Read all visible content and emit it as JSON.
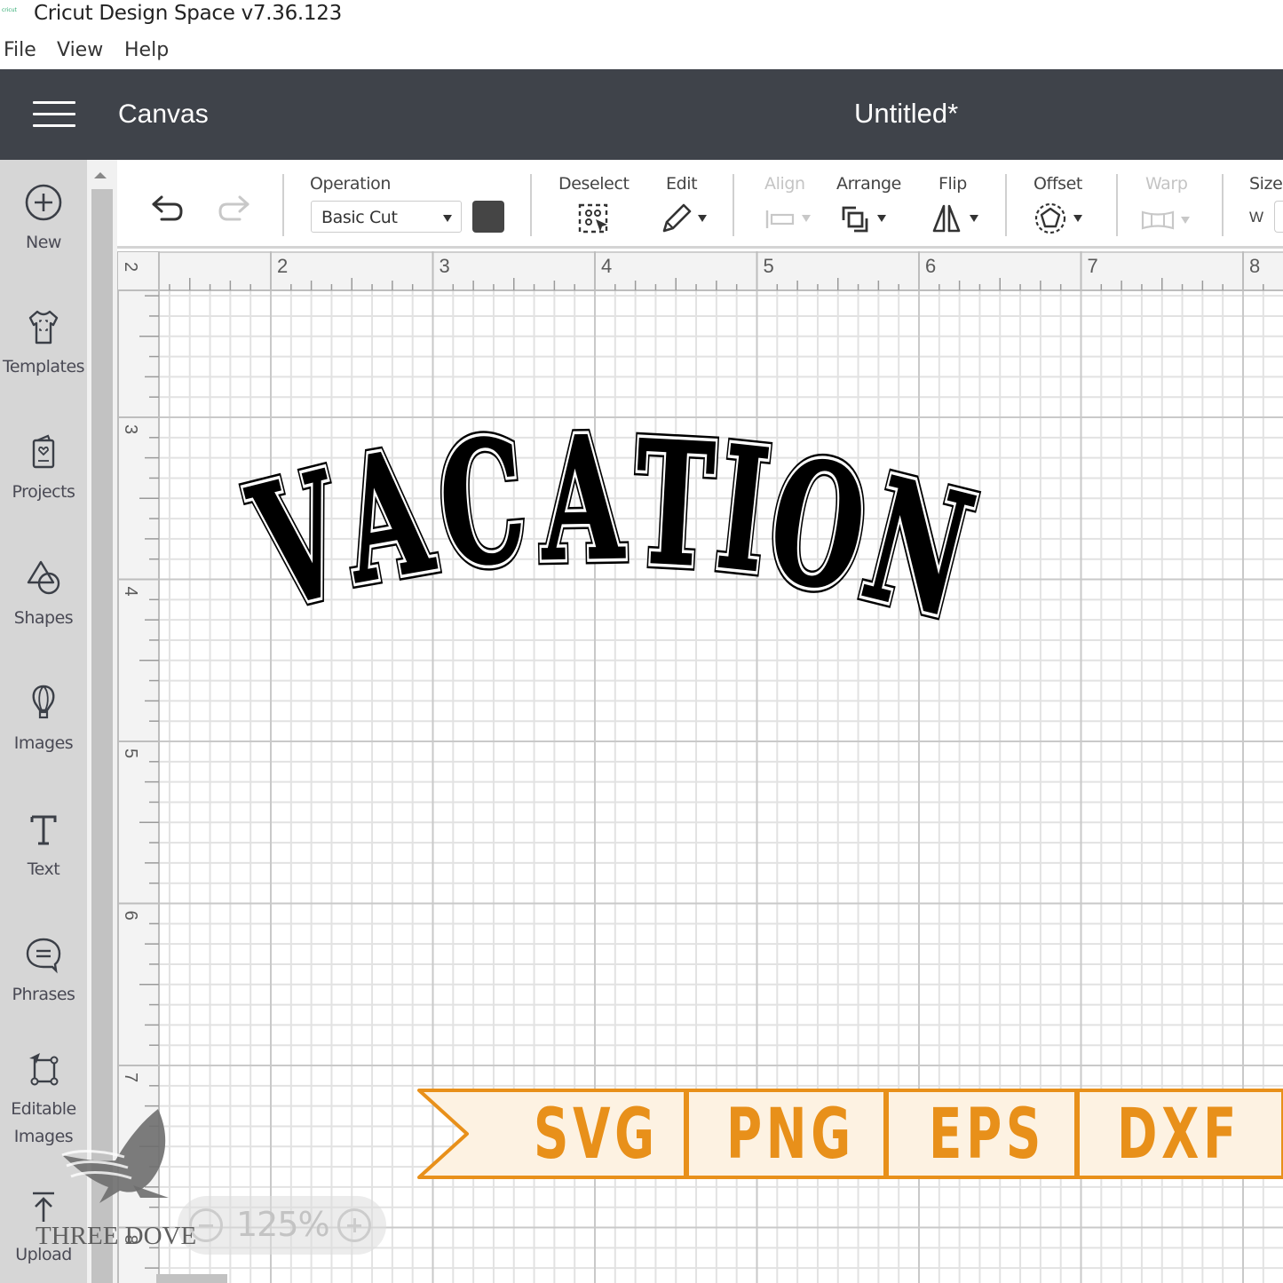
{
  "window": {
    "app_title": "Cricut Design Space  v7.36.123",
    "logo_text": "cricut"
  },
  "menu": [
    "File",
    "View",
    "Help"
  ],
  "header": {
    "section": "Canvas",
    "document_title": "Untitled*"
  },
  "sidebar": {
    "items": [
      {
        "label": "New",
        "icon": "plus-circle-icon"
      },
      {
        "label": "Templates",
        "icon": "tshirt-icon"
      },
      {
        "label": "Projects",
        "icon": "card-heart-icon"
      },
      {
        "label": "Shapes",
        "icon": "shapes-icon"
      },
      {
        "label": "Images",
        "icon": "balloon-icon"
      },
      {
        "label": "Text",
        "icon": "text-t-icon"
      },
      {
        "label": "Phrases",
        "icon": "speech-bubble-icon"
      },
      {
        "label": "Editable Images",
        "label_lines": [
          "Editable",
          "Images"
        ],
        "icon": "edit-image-icon"
      },
      {
        "label": "Upload",
        "icon": "upload-icon"
      }
    ]
  },
  "toolbar": {
    "undo": "undo-icon",
    "redo": "redo-icon",
    "operation": {
      "label": "Operation",
      "value": "Basic Cut",
      "color": "#454545"
    },
    "deselect": "Deselect",
    "edit": "Edit",
    "align": {
      "label": "Align",
      "disabled": true
    },
    "arrange": "Arrange",
    "flip": "Flip",
    "offset": "Offset",
    "warp": {
      "label": "Warp",
      "disabled": true
    },
    "size": {
      "label": "Size",
      "w_label": "W"
    }
  },
  "rulers": {
    "horizontal": [
      "2",
      "3",
      "4",
      "5",
      "6",
      "7",
      "8"
    ],
    "horizontal_corner": "2",
    "vertical": [
      "3",
      "4",
      "5",
      "6",
      "7",
      "8"
    ]
  },
  "canvas": {
    "design_text": "VACATION",
    "design_letters": [
      "V",
      "A",
      "C",
      "A",
      "T",
      "I",
      "O",
      "N"
    ],
    "design_color": "#000000",
    "zoom": "125%"
  },
  "banner": {
    "formats": [
      "SVG",
      "PNG",
      "EPS",
      "DXF"
    ],
    "text_color": "#e8901a",
    "background": "#fdf2e2"
  },
  "watermark": {
    "text": "THREE DOVE"
  }
}
